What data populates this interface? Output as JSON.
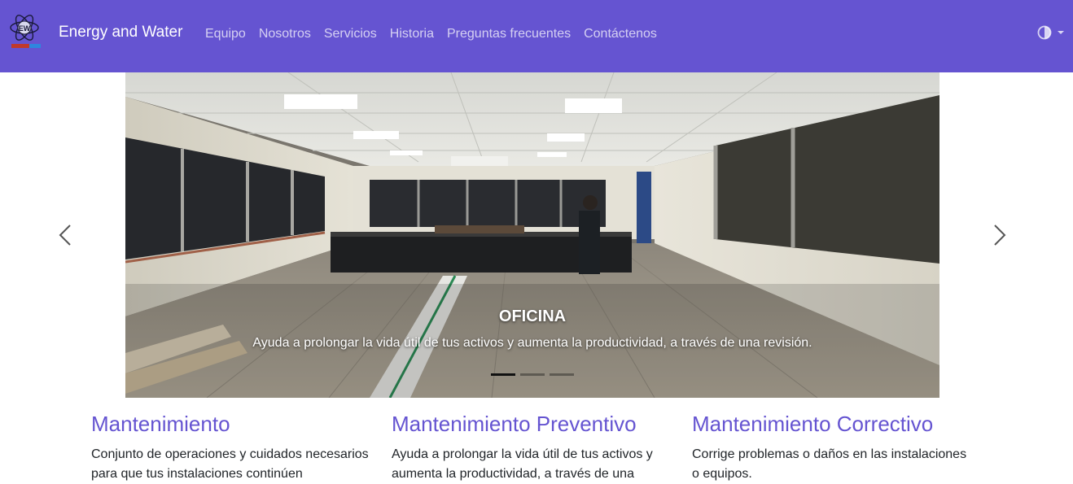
{
  "navbar": {
    "brand": "Energy and Water",
    "links": [
      "Equipo",
      "Nosotros",
      "Servicios",
      "Historia",
      "Preguntas frecuentes",
      "Contáctenos"
    ],
    "logo_text": "EW",
    "theme_icon": "half-circle-icon",
    "dropdown_icon": "caret-down-icon"
  },
  "carousel": {
    "caption_title": "OFICINA",
    "caption_text": "Ayuda a prolongar la vida útil de tus activos y aumenta la productividad, a través de una revisión.",
    "active_slide": 1,
    "slide_count": 3
  },
  "services": [
    {
      "title": "Mantenimiento",
      "text": "Conjunto de operaciones y cuidados necesarios para que tus instalaciones continúen"
    },
    {
      "title": "Mantenimiento Preventivo",
      "text": "Ayuda a prolongar la vida útil de tus activos y aumenta la productividad, a través de una"
    },
    {
      "title": "Mantenimiento Correctivo",
      "text": "Corrige problemas o daños en las instalaciones o equipos."
    }
  ],
  "colors": {
    "navbar": "#6554d1",
    "heading": "#6554d1"
  }
}
